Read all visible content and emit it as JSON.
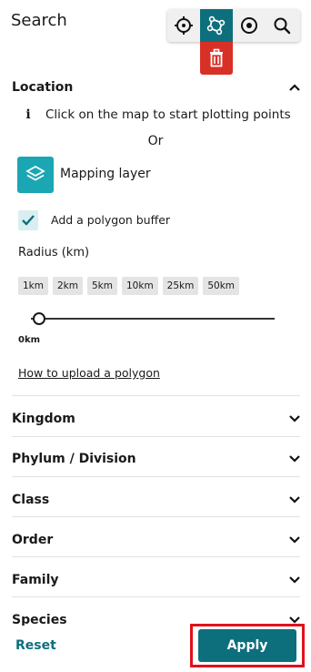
{
  "header": {
    "title": "Search"
  },
  "toolbar": {
    "tools": [
      "crosshair-icon",
      "polygon-icon",
      "target-icon",
      "search-icon"
    ],
    "active_tool": "polygon-icon"
  },
  "location": {
    "heading": "Location",
    "hint": "Click on the map to start plotting points",
    "or": "Or",
    "mapping_layer": "Mapping layer",
    "buffer_label": "Add a polygon buffer",
    "buffer_checked": true,
    "radius_label": "Radius (km)",
    "radius_options": [
      "1km",
      "2km",
      "5km",
      "10km",
      "25km",
      "50km"
    ],
    "slider_value": "0km",
    "upload_link": "How to upload a polygon"
  },
  "filters": [
    "Kingdom",
    "Phylum / Division",
    "Class",
    "Order",
    "Family",
    "Species"
  ],
  "footer": {
    "reset": "Reset",
    "apply": "Apply"
  },
  "colors": {
    "accent": "#0e6f7c",
    "layer": "#1ba6b3",
    "danger": "#d93025",
    "highlight": "#e0111b"
  }
}
